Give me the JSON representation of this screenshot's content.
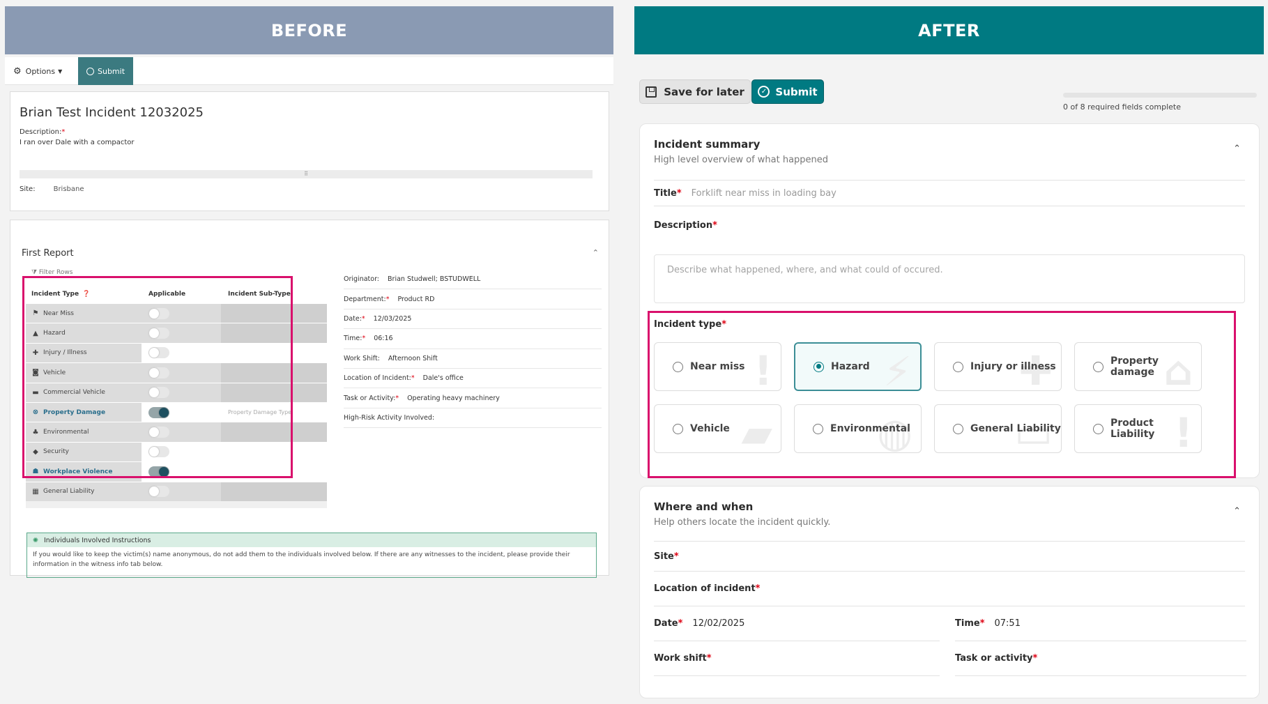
{
  "before": {
    "banner": "BEFORE",
    "toolbar": {
      "options_label": "Options",
      "submit_label": "Submit"
    },
    "incident": {
      "title": "Brian Test Incident 12032025",
      "description_label": "Description:",
      "description": "I ran over Dale with a compactor",
      "site_label": "Site:",
      "site": "Brisbane"
    },
    "first_report": {
      "title": "First Report",
      "filter_label": "Filter Rows",
      "table_headers": [
        "Incident Type",
        "Applicable",
        "Incident Sub-Type"
      ],
      "rows": [
        {
          "label": "Near Miss",
          "icon": "⚑",
          "on": false,
          "sub": ""
        },
        {
          "label": "Hazard",
          "icon": "▲",
          "on": false,
          "sub": ""
        },
        {
          "label": "Injury / Illness",
          "icon": "✚",
          "on": false,
          "sub": ""
        },
        {
          "label": "Vehicle",
          "icon": "◙",
          "on": false,
          "sub": ""
        },
        {
          "label": "Commercial Vehicle",
          "icon": "▬",
          "on": false,
          "sub": ""
        },
        {
          "label": "Property Damage",
          "icon": "⊗",
          "on": true,
          "sub": "Property Damage Type"
        },
        {
          "label": "Environmental",
          "icon": "♣",
          "on": false,
          "sub": ""
        },
        {
          "label": "Security",
          "icon": "◆",
          "on": false,
          "sub": ""
        },
        {
          "label": "Workplace Violence",
          "icon": "☗",
          "on": true,
          "sub": ""
        },
        {
          "label": "General Liability",
          "icon": "▦",
          "on": false,
          "sub": ""
        }
      ],
      "details": [
        {
          "label": "Originator:",
          "required": false,
          "value": "Brian Studwell; BSTUDWELL"
        },
        {
          "label": "Department:",
          "required": true,
          "value": "Product RD"
        },
        {
          "label": "Date:",
          "required": true,
          "value": "12/03/2025"
        },
        {
          "label": "Time:",
          "required": true,
          "value": "06:16"
        },
        {
          "label": "Work Shift:",
          "required": false,
          "value": "Afternoon Shift"
        },
        {
          "label": "Location of Incident:",
          "required": true,
          "value": "Dale's office"
        },
        {
          "label": "Task or Activity:",
          "required": true,
          "value": "Operating heavy machinery"
        },
        {
          "label": "High-Risk Activity Involved:",
          "required": false,
          "value": ""
        }
      ],
      "instructions_title": "Individuals Involved Instructions",
      "instructions_text": "If you would like to keep the victim(s) name anonymous, do not add them to the individuals involved below. If there are any witnesses to the incident, please provide their information in the witness info tab below."
    }
  },
  "after": {
    "banner": "AFTER",
    "toolbar": {
      "save_label": "Save for later",
      "submit_label": "Submit"
    },
    "progress": {
      "text": "0 of 8 required fields complete",
      "fraction": 0
    },
    "summary": {
      "title": "Incident summary",
      "subtitle": "High level overview of what happened",
      "title_label": "Title",
      "title_placeholder": "Forklift near miss in loading bay",
      "description_label": "Description",
      "description_placeholder": "Describe what happened, where, and what could of occured.",
      "incident_type_label": "Incident type",
      "options": [
        {
          "label": "Near miss",
          "icon": "!",
          "selected": false
        },
        {
          "label": "Hazard",
          "icon": "⚡",
          "selected": true
        },
        {
          "label": "Injury or illness",
          "icon": "✚",
          "selected": false
        },
        {
          "label": "Property damage",
          "icon": "⌂",
          "selected": false
        },
        {
          "label": "Vehicle",
          "icon": "▰",
          "selected": false
        },
        {
          "label": "Environmental",
          "icon": "◍",
          "selected": false
        },
        {
          "label": "General Liability",
          "icon": "▭",
          "selected": false
        },
        {
          "label": "Product Liability",
          "icon": "!",
          "selected": false
        }
      ]
    },
    "where": {
      "title": "Where and when",
      "subtitle": "Help others locate the incident quickly.",
      "site_label": "Site",
      "location_label": "Location of incident",
      "date_label": "Date",
      "date_value": "12/02/2025",
      "time_label": "Time",
      "time_value": "07:51",
      "shift_label": "Work shift",
      "task_label": "Task or activity"
    }
  },
  "colors": {
    "before_banner": "#8a9ab3",
    "after_banner": "#007a82",
    "highlight": "#d9106c",
    "accent": "#007a82"
  }
}
